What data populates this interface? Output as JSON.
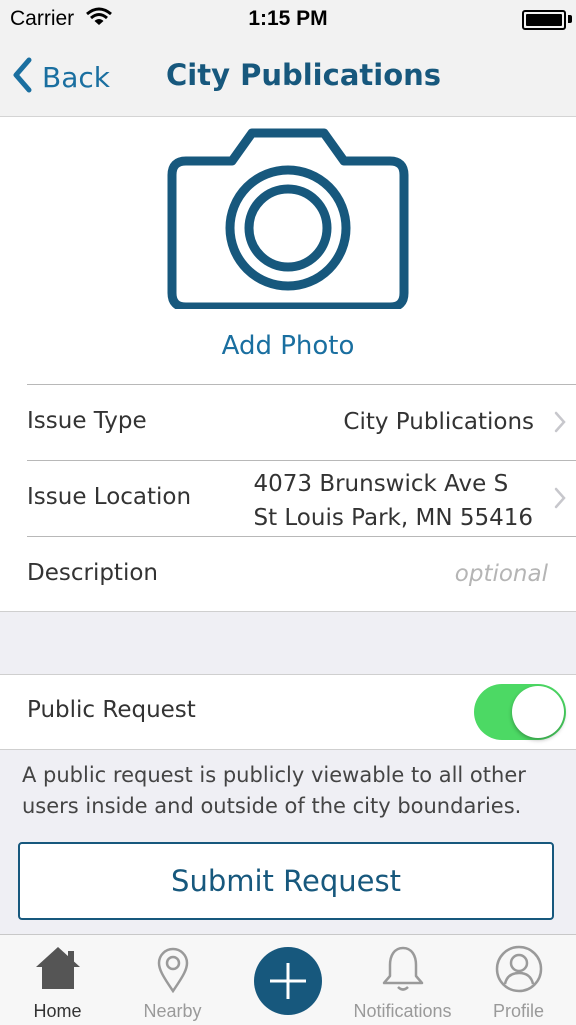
{
  "status_bar": {
    "carrier": "Carrier",
    "time": "1:15 PM"
  },
  "nav": {
    "back_label": "Back",
    "title": "City Publications"
  },
  "photo": {
    "add_label": "Add Photo"
  },
  "form": {
    "issue_type": {
      "label": "Issue Type",
      "value": "City Publications"
    },
    "issue_location": {
      "label": "Issue Location",
      "line1": "4073 Brunswick Ave S",
      "line2": "St Louis Park, MN 55416"
    },
    "description": {
      "label": "Description",
      "placeholder": "optional"
    }
  },
  "public_request": {
    "label": "Public Request",
    "enabled": true,
    "note": "A public request is publicly viewable to all other users inside and outside of the city boundaries."
  },
  "submit_label": "Submit Request",
  "tabs": [
    {
      "label": "Home",
      "icon": "home-icon",
      "active": true
    },
    {
      "label": "Nearby",
      "icon": "location-pin-icon",
      "active": false
    },
    {
      "label": "",
      "icon": "plus-icon",
      "active": false
    },
    {
      "label": "Notifications",
      "icon": "bell-icon",
      "active": false
    },
    {
      "label": "Profile",
      "icon": "profile-icon",
      "active": false
    }
  ],
  "colors": {
    "primary": "#17587d",
    "link": "#1a6fa0",
    "toggle_on": "#4cd964"
  }
}
